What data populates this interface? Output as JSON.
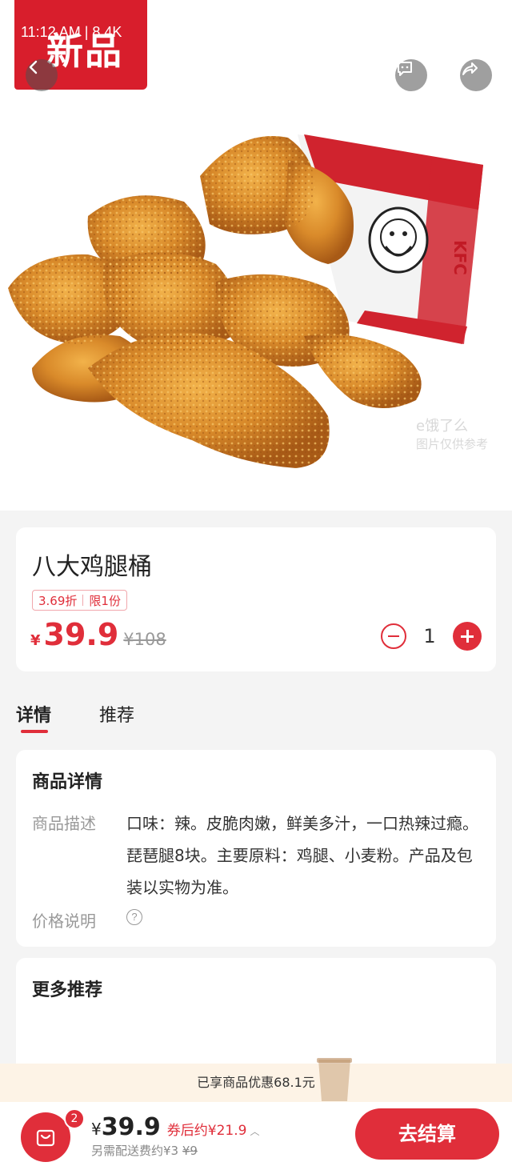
{
  "status_bar": {
    "text": "11:12 AM | 8.4K"
  },
  "hero": {
    "badge_text": "新品",
    "bucket_logo_text": "KFC",
    "watermark_line1": "e饿了么",
    "watermark_line2": "图片仅供参考"
  },
  "product": {
    "name": "八大鸡腿桶",
    "tags": [
      "3.69折",
      "限1份"
    ],
    "currency": "¥",
    "price": "39.9",
    "original_price": "¥108",
    "quantity": "1"
  },
  "tabs": [
    {
      "label": "详情",
      "active": true
    },
    {
      "label": "推荐",
      "active": false
    }
  ],
  "details": {
    "title": "商品详情",
    "desc_label": "商品描述",
    "desc_text": "口味：辣。皮脆肉嫩，鲜美多汁，一口热辣过瘾。琵琶腿8块。主要原料：鸡腿、小麦粉。产品及包装以实物为准。",
    "price_label": "价格说明",
    "help_icon": "?"
  },
  "more": {
    "title": "更多推荐"
  },
  "discount_banner": {
    "text": "已享商品优惠68.1元"
  },
  "bottom_bar": {
    "cart_count": "2",
    "total_currency": "¥",
    "total_price": "39.9",
    "coupon_text": "券后约¥21.9",
    "delivery_prefix": "另需配送费约¥3",
    "delivery_original": "¥9",
    "checkout_label": "去结算"
  },
  "colors": {
    "accent": "#e02e3a",
    "banner_bg": "#fdf3e6",
    "badge_red": "#d81e2c"
  }
}
